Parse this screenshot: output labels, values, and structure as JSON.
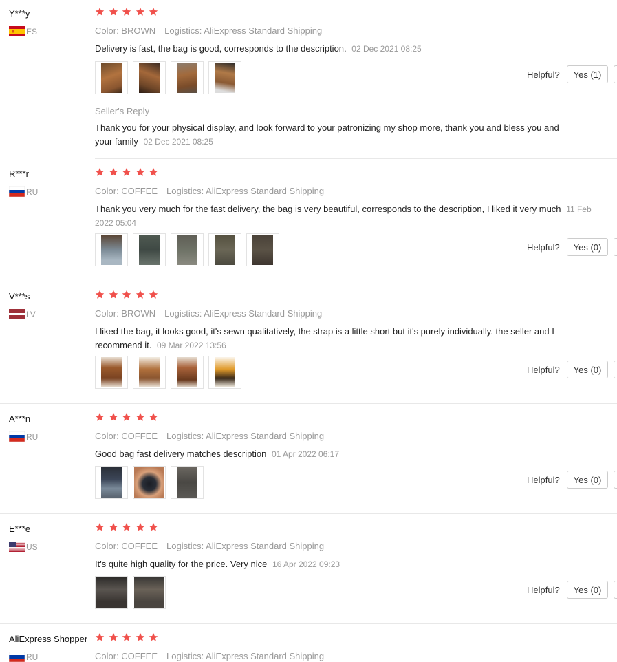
{
  "colors": {
    "star": "#f0514c",
    "muted": "#999999",
    "border": "#cccccc"
  },
  "icons": {
    "star": "star-icon",
    "photo": "review-photo"
  },
  "helpful_label": "Helpful?",
  "seller_reply_label": "Seller's Reply",
  "reviews": [
    {
      "user": "Y***y",
      "country": "ES",
      "flag": "es",
      "stars": 5,
      "color": "Color: BROWN",
      "logistics": "Logistics: AliExpress Standard Shipping",
      "text": "Delivery is fast, the bag is good, corresponds to the description.",
      "date": "02 Dec 2021 08:25",
      "yes": "Yes (1)",
      "photos": [
        "brown bag",
        "brown bag",
        "brown bag",
        "brown bag"
      ],
      "seller_reply": {
        "text": "Thank you for your physical display, and look forward to your patronizing my shop more, thank you and bless you and your family",
        "date": "02 Dec 2021 08:25"
      }
    },
    {
      "user": "R***r",
      "country": "RU",
      "flag": "ru",
      "stars": 5,
      "color": "Color: COFFEE",
      "logistics": "Logistics: AliExpress Standard Shipping",
      "text": "Thank you very much for the fast delivery, the bag is very beautiful, corresponds to the description, I liked it very much",
      "date": "11 Feb 2022 05:04",
      "yes": "Yes (0)",
      "photos": [
        "coffee bag",
        "coffee bag",
        "coffee bag",
        "coffee bag",
        "coffee bag"
      ]
    },
    {
      "user": "V***s",
      "country": "LV",
      "flag": "lv",
      "stars": 5,
      "color": "Color: BROWN",
      "logistics": "Logistics: AliExpress Standard Shipping",
      "text": "I liked the bag, it looks good, it's sewn qualitatively, the strap is a little short but it's purely individually. the seller and I recommend it.",
      "date": "09 Mar 2022 13:56",
      "yes": "Yes (0)",
      "photos": [
        "brown bag",
        "brown bag",
        "brown bag",
        "brown bag"
      ]
    },
    {
      "user": "A***n",
      "country": "RU",
      "flag": "ru",
      "stars": 5,
      "color": "Color: COFFEE",
      "logistics": "Logistics: AliExpress Standard Shipping",
      "text": "Good bag fast delivery matches description",
      "date": "01 Apr 2022 06:17",
      "yes": "Yes (0)",
      "photos": [
        "coffee bag",
        "coffee bag",
        "coffee bag"
      ]
    },
    {
      "user": "E***e",
      "country": "US",
      "flag": "us",
      "stars": 5,
      "color": "Color: COFFEE",
      "logistics": "Logistics: AliExpress Standard Shipping",
      "text": "It's quite high quality for the price. Very nice",
      "date": "16 Apr 2022 09:23",
      "yes": "Yes (0)",
      "photos": [
        "coffee bag",
        "coffee bag"
      ]
    },
    {
      "user": "AliExpress Shopper",
      "country": "RU",
      "flag": "ru",
      "stars": 5,
      "color": "Color: COFFEE",
      "logistics": "Logistics: AliExpress Standard Shipping"
    }
  ]
}
